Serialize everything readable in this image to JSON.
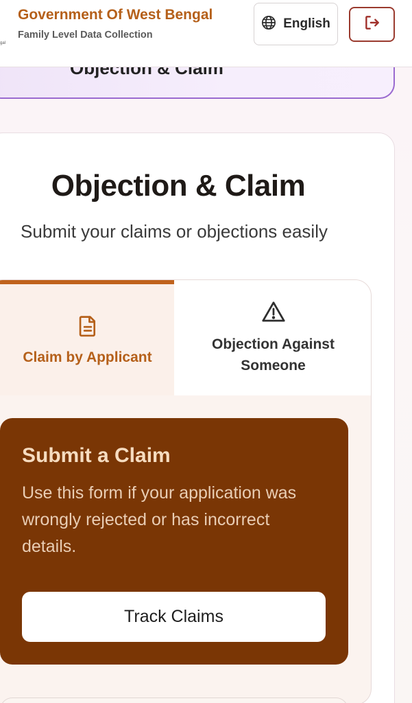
{
  "header": {
    "title": "Government Of West Bengal",
    "subtitle": "Family Level Data Collection",
    "logo_caption": "gal",
    "language_label": "English",
    "language_icon": "globe-icon",
    "logout_icon": "logout-icon",
    "accent_color": "#b5601a"
  },
  "previous_card": {
    "label": "Objection & Claim"
  },
  "main": {
    "title": "Objection & Claim",
    "subtitle": "Submit your claims or objections easily",
    "tabs": [
      {
        "label": "Claim by Applicant",
        "icon": "document-icon",
        "active": true
      },
      {
        "label": "Objection Against Someone",
        "icon": "warning-icon",
        "active": false
      }
    ],
    "claim_panel": {
      "title": "Submit a Claim",
      "description": "Use this form if your application was wrongly rejected or has incorrect details.",
      "button_label": "Track Claims",
      "background_color": "#7a3605"
    }
  }
}
